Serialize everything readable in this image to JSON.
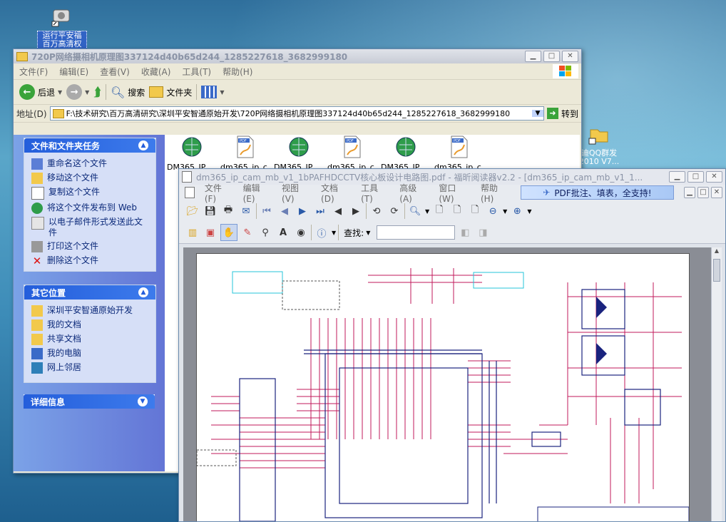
{
  "desktop": {
    "icon1_label": "运行平安福 百万高清权",
    "icon2_label": "迪QQ群发 2010 V7..."
  },
  "explorer": {
    "title": "720P网络摄相机原理图337124d40b65d244_1285227618_3682999180",
    "menu": [
      "文件(F)",
      "编辑(E)",
      "查看(V)",
      "收藏(A)",
      "工具(T)",
      "帮助(H)"
    ],
    "back": "后退",
    "search": "搜索",
    "folders": "文件夹",
    "address_label": "地址(D)",
    "address": "F:\\技术研究\\百万高清研究\\深圳平安智通原始开发\\720P网络摄相机原理图337124d40b65d244_1285227618_3682999180",
    "go": "转到",
    "tasks_title": "文件和文件夹任务",
    "tasks": [
      "重命名这个文件",
      "移动这个文件",
      "复制这个文件",
      "将这个文件发布到 Web",
      "以电子邮件形式发送此文件",
      "打印这个文件",
      "删除这个文件"
    ],
    "places_title": "其它位置",
    "places": [
      "深圳平安智通原始开发",
      "我的文档",
      "共享文档",
      "我的电脑",
      "网上邻居"
    ],
    "details_title": "详细信息",
    "files": [
      "DM365_IP_...",
      "dm365_ip_c...",
      "DM365_IP_...",
      "dm365_ip_c...",
      "DM365_IP_...",
      "dm365_ip_c..."
    ]
  },
  "reader": {
    "title": "dm365_ip_cam_mb_v1_1bPAFHDCCTV核心板设计电路图.pdf - 福昕阅读器v2.2 - [dm365_ip_cam_mb_v1_1...",
    "menu": [
      "文件(F)",
      "编辑(E)",
      "视图(V)",
      "文档(D)",
      "工具(T)",
      "高级(A)",
      "窗口(W)",
      "帮助(H)"
    ],
    "promo": "PDF批注、填表，全支持!",
    "find_label": "查找:"
  }
}
